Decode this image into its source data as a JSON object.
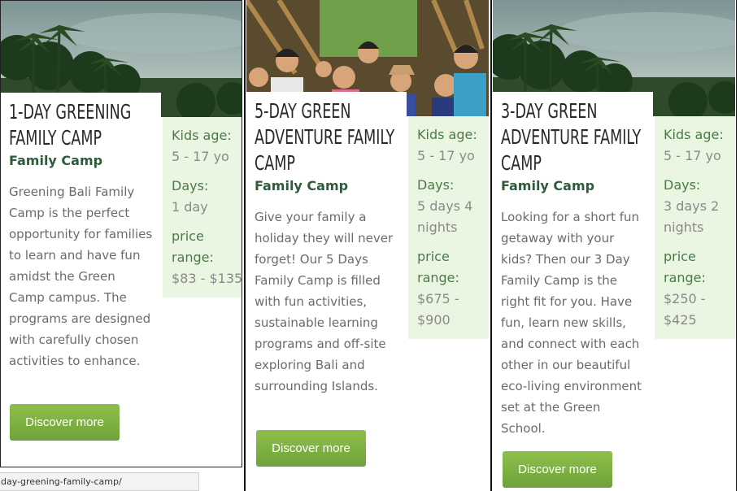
{
  "cards": [
    {
      "title": "1-Day Greening Family Camp",
      "subtitle": "Family Camp",
      "description": "Greening Bali Family Camp is the perfect opportunity for families to learn and have fun amidst the Green Camp campus. The programs are designed with carefully chosen activities to enhance.",
      "kids_age_label": "Kids age:",
      "kids_age": "5 - 17 yo",
      "days_label": "Days:",
      "days": "1 day",
      "price_label": "price range:",
      "price": "$83 - $135",
      "button": "Discover more"
    },
    {
      "title": "5-Day Green Adventure Family Camp",
      "subtitle": "Family Camp",
      "description": "Give your family a holiday they will never forget! Our 5 Days Family Camp is filled with fun activities, sustainable learning programs and off-site exploring Bali and surrounding Islands.",
      "kids_age_label": "Kids age:",
      "kids_age": "5 - 17 yo",
      "days_label": "Days:",
      "days": "5 days 4 nights",
      "price_label": "price range:",
      "price": "$675 - $900",
      "button": "Discover more"
    },
    {
      "title": "3-Day Green Adventure Family Camp",
      "subtitle": "Family Camp",
      "description": "Looking for a short fun getaway with your kids? Then our 3 Day Family Camp is the right fit for you. Have fun, learn new skills, and connect with each other in our beautiful eco-living environment set at the Green School.",
      "kids_age_label": "Kids age:",
      "kids_age": "5 - 17 yo",
      "days_label": "Days:",
      "days": "3 days 2 nights",
      "price_label": "price range:",
      "price": "$250 - $425",
      "button": "Discover more"
    }
  ],
  "status_bar": "day-greening-family-camp/",
  "colors": {
    "accent_green": "#7aad3f",
    "panel_bg": "#eaf6e2",
    "subtitle_green": "#2e5c3a"
  }
}
